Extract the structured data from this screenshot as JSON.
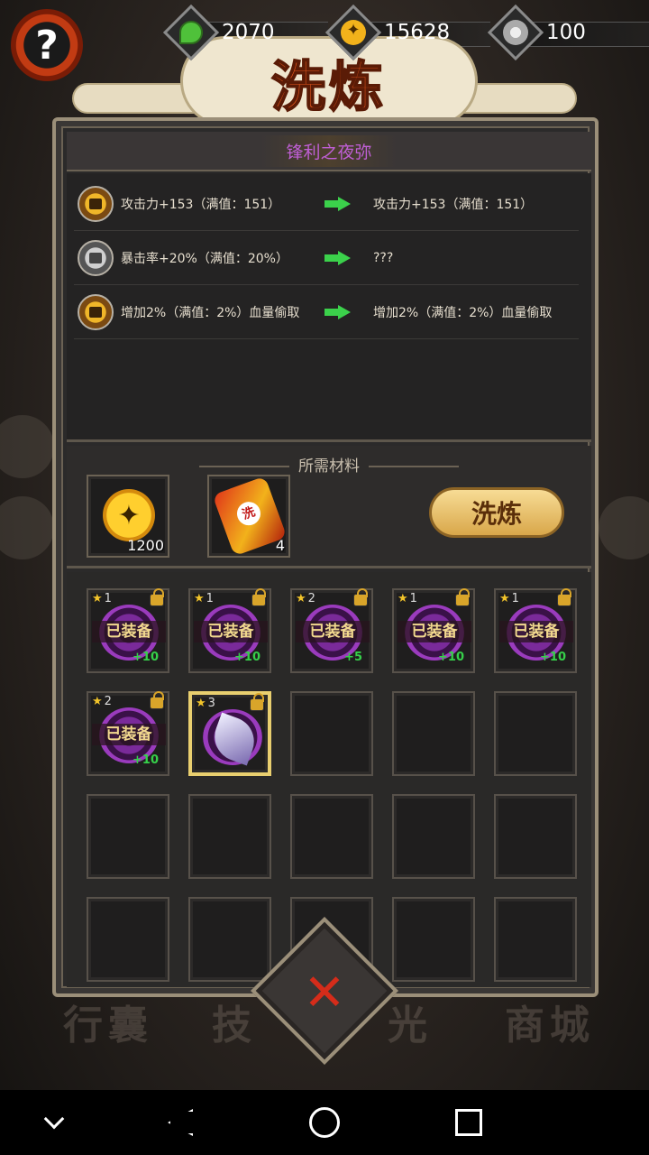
{
  "resources": [
    {
      "icon": "green-flame-icon",
      "value": "2070"
    },
    {
      "icon": "gold-coin-icon",
      "value": "15628"
    },
    {
      "icon": "silver-coin-icon",
      "value": "100"
    }
  ],
  "help_label": "?",
  "title": "洗炼",
  "item_name": "锋利之夜弥",
  "attributes": [
    {
      "locked": true,
      "current": "攻击力+153（满值：151）",
      "next": "攻击力+153（满值：151）"
    },
    {
      "locked": false,
      "current": "暴击率+20%（满值：20%）",
      "next": "???"
    },
    {
      "locked": true,
      "current": "增加2%（满值：2%）血量偷取",
      "next": "增加2%（满值：2%）血量偷取"
    }
  ],
  "materials": {
    "title": "所需材料",
    "coin": {
      "icon": "gold-coin-icon",
      "count": "1200"
    },
    "scroll": {
      "icon": "scroll-icon",
      "count": "4",
      "mark": "洗"
    },
    "refine_button": "洗炼"
  },
  "inventory": [
    {
      "stars": "1",
      "equipped": "已装备",
      "plus": "+10",
      "locked": true
    },
    {
      "stars": "1",
      "equipped": "已装备",
      "plus": "+10",
      "locked": true
    },
    {
      "stars": "2",
      "equipped": "已装备",
      "plus": "+5",
      "locked": true
    },
    {
      "stars": "1",
      "equipped": "已装备",
      "plus": "+10",
      "locked": true
    },
    {
      "stars": "1",
      "equipped": "已装备",
      "plus": "+10",
      "locked": true
    },
    {
      "stars": "2",
      "equipped": "已装备",
      "plus": "+10",
      "locked": true
    },
    {
      "stars": "3",
      "equipped": "",
      "plus": "",
      "locked": true,
      "selected": true
    }
  ],
  "background_labels": [
    "行囊",
    "技",
    "光",
    "商城"
  ],
  "close_symbol": "✕",
  "colors": {
    "accent": "#e5571c",
    "item_name": "#c05fd6",
    "arrow": "#3bd14b",
    "plus": "#36d04a",
    "close": "#d52c1a"
  }
}
